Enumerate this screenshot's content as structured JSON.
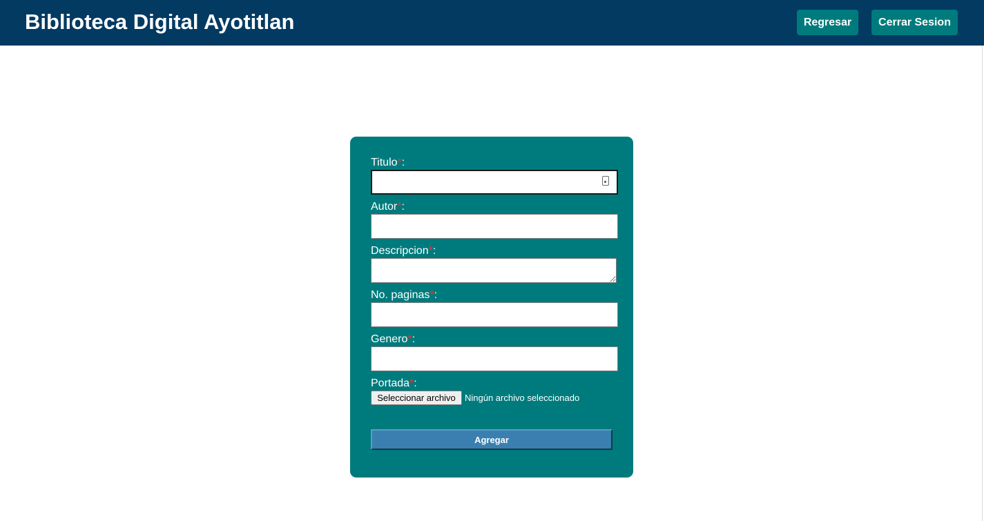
{
  "header": {
    "title": "Biblioteca Digital Ayotitlan",
    "back_label": "Regresar",
    "logout_label": "Cerrar Sesion"
  },
  "form": {
    "required_mark": "*",
    "fields": {
      "titulo": {
        "label": "Titulo",
        "value": ""
      },
      "autor": {
        "label": "Autor",
        "value": ""
      },
      "descripcion": {
        "label": "Descripcion",
        "value": ""
      },
      "paginas": {
        "label": "No. paginas",
        "value": ""
      },
      "genero": {
        "label": "Genero",
        "value": ""
      },
      "portada": {
        "label": "Portada",
        "button_label": "Seleccionar archivo",
        "status": "Ningún archivo seleccionado"
      }
    },
    "submit_label": "Agregar"
  },
  "colors": {
    "header_bg": "#023a62",
    "accent": "#007b7d",
    "submit": "#3a7fb0",
    "required": "#ff2a2a"
  },
  "icons": {
    "autofill": "contact-card-icon"
  }
}
